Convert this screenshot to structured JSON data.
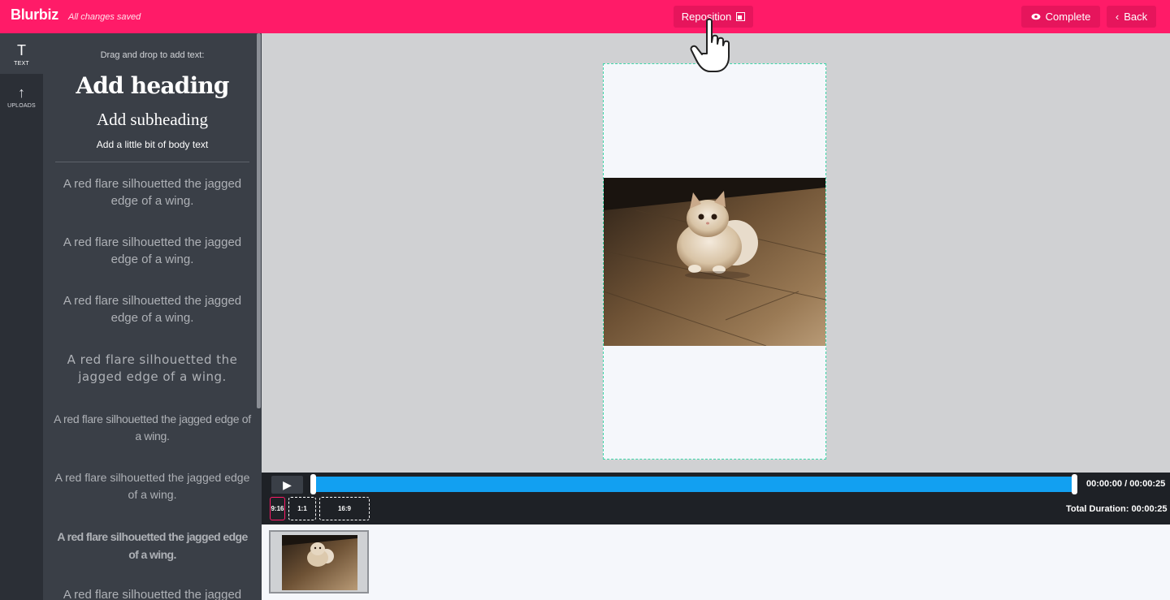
{
  "header": {
    "logo": "Blurbiz",
    "status": "All changes saved",
    "reposition_label": "Reposition",
    "complete_label": "Complete",
    "back_label": "Back"
  },
  "rail": {
    "items": [
      {
        "label": "TEXT",
        "icon": "text-icon"
      },
      {
        "label": "UPLOADS",
        "icon": "upload-arrow-icon"
      }
    ]
  },
  "text_panel": {
    "hint": "Drag and drop to add text:",
    "heading": "Add heading",
    "subheading": "Add subheading",
    "body": "Add a little bit of body text",
    "samples": [
      "A red flare silhouetted the jagged edge of a wing.",
      "A red flare silhouetted the jagged edge of a wing.",
      "A red flare silhouetted the jagged edge of a wing.",
      "A red flare silhouetted the jagged edge of a wing.",
      "A red flare silhouetted the jagged edge of a wing.",
      "A red flare silhouetted the jagged edge of a wing.",
      "A red flare silhouetted the jagged edge of a wing.",
      "A red flare silhouetted the jagged"
    ]
  },
  "timeline": {
    "time": "00:00:00 / 00:00:25",
    "ratios": [
      "9:16",
      "1:1",
      "16:9"
    ],
    "selected_ratio": "9:16",
    "total_duration": "Total Duration: 00:00:25"
  },
  "colors": {
    "brand": "#ff1b68",
    "track": "#12a0f1",
    "selection": "#3fd6a9"
  }
}
